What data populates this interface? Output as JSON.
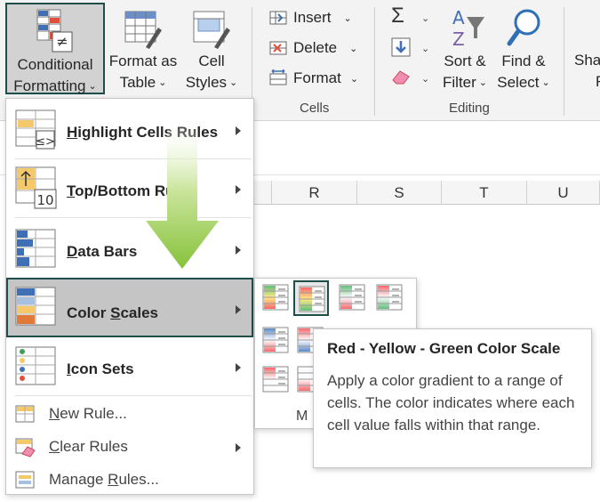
{
  "ribbon": {
    "conditional_formatting": {
      "line1": "Conditional",
      "line2": "Formatting"
    },
    "format_as_table": {
      "line1": "Format as",
      "line2": "Table"
    },
    "cell_styles": {
      "line1": "Cell",
      "line2": "Styles"
    },
    "insert_label": "Insert",
    "delete_label": "Delete",
    "format_label": "Format",
    "cells_group": "Cells",
    "sort_filter": {
      "line1": "Sort &",
      "line2": "Filter"
    },
    "find_select": {
      "line1": "Find &",
      "line2": "Select"
    },
    "editing_group": "Editing",
    "share_partial": {
      "line1": "Sha",
      "line2": "F"
    }
  },
  "grid": {
    "columns": [
      "R",
      "S",
      "T",
      "U"
    ]
  },
  "menu": {
    "items": [
      {
        "label_pre": "",
        "label_u": "H",
        "label_post": "ighlight Cells Rules"
      },
      {
        "label_pre": "",
        "label_u": "T",
        "label_post": "op/Bottom Rules"
      },
      {
        "label_pre": "",
        "label_u": "D",
        "label_post": "ata Bars"
      },
      {
        "label_pre": "Color ",
        "label_u": "S",
        "label_post": "cales"
      },
      {
        "label_pre": "",
        "label_u": "I",
        "label_post": "con Sets"
      }
    ],
    "small_items": [
      {
        "label_pre": "",
        "label_u": "N",
        "label_post": "ew Rule..."
      },
      {
        "label_pre": "",
        "label_u": "C",
        "label_post": "lear Rules"
      },
      {
        "label_pre": "Manage ",
        "label_u": "R",
        "label_post": "ules..."
      }
    ],
    "topbottom_icon_number": "10"
  },
  "submenu": {
    "more_rules_visible": "M"
  },
  "tooltip": {
    "title": "Red - Yellow - Green Color Scale",
    "body": "Apply a color gradient to a range of cells. The color indicates where each cell value falls within that range."
  },
  "colors": {
    "accent_border": "#1f4e4a",
    "selected_bg": "#c5c5c5",
    "arrow_green": "#8dc63f"
  }
}
